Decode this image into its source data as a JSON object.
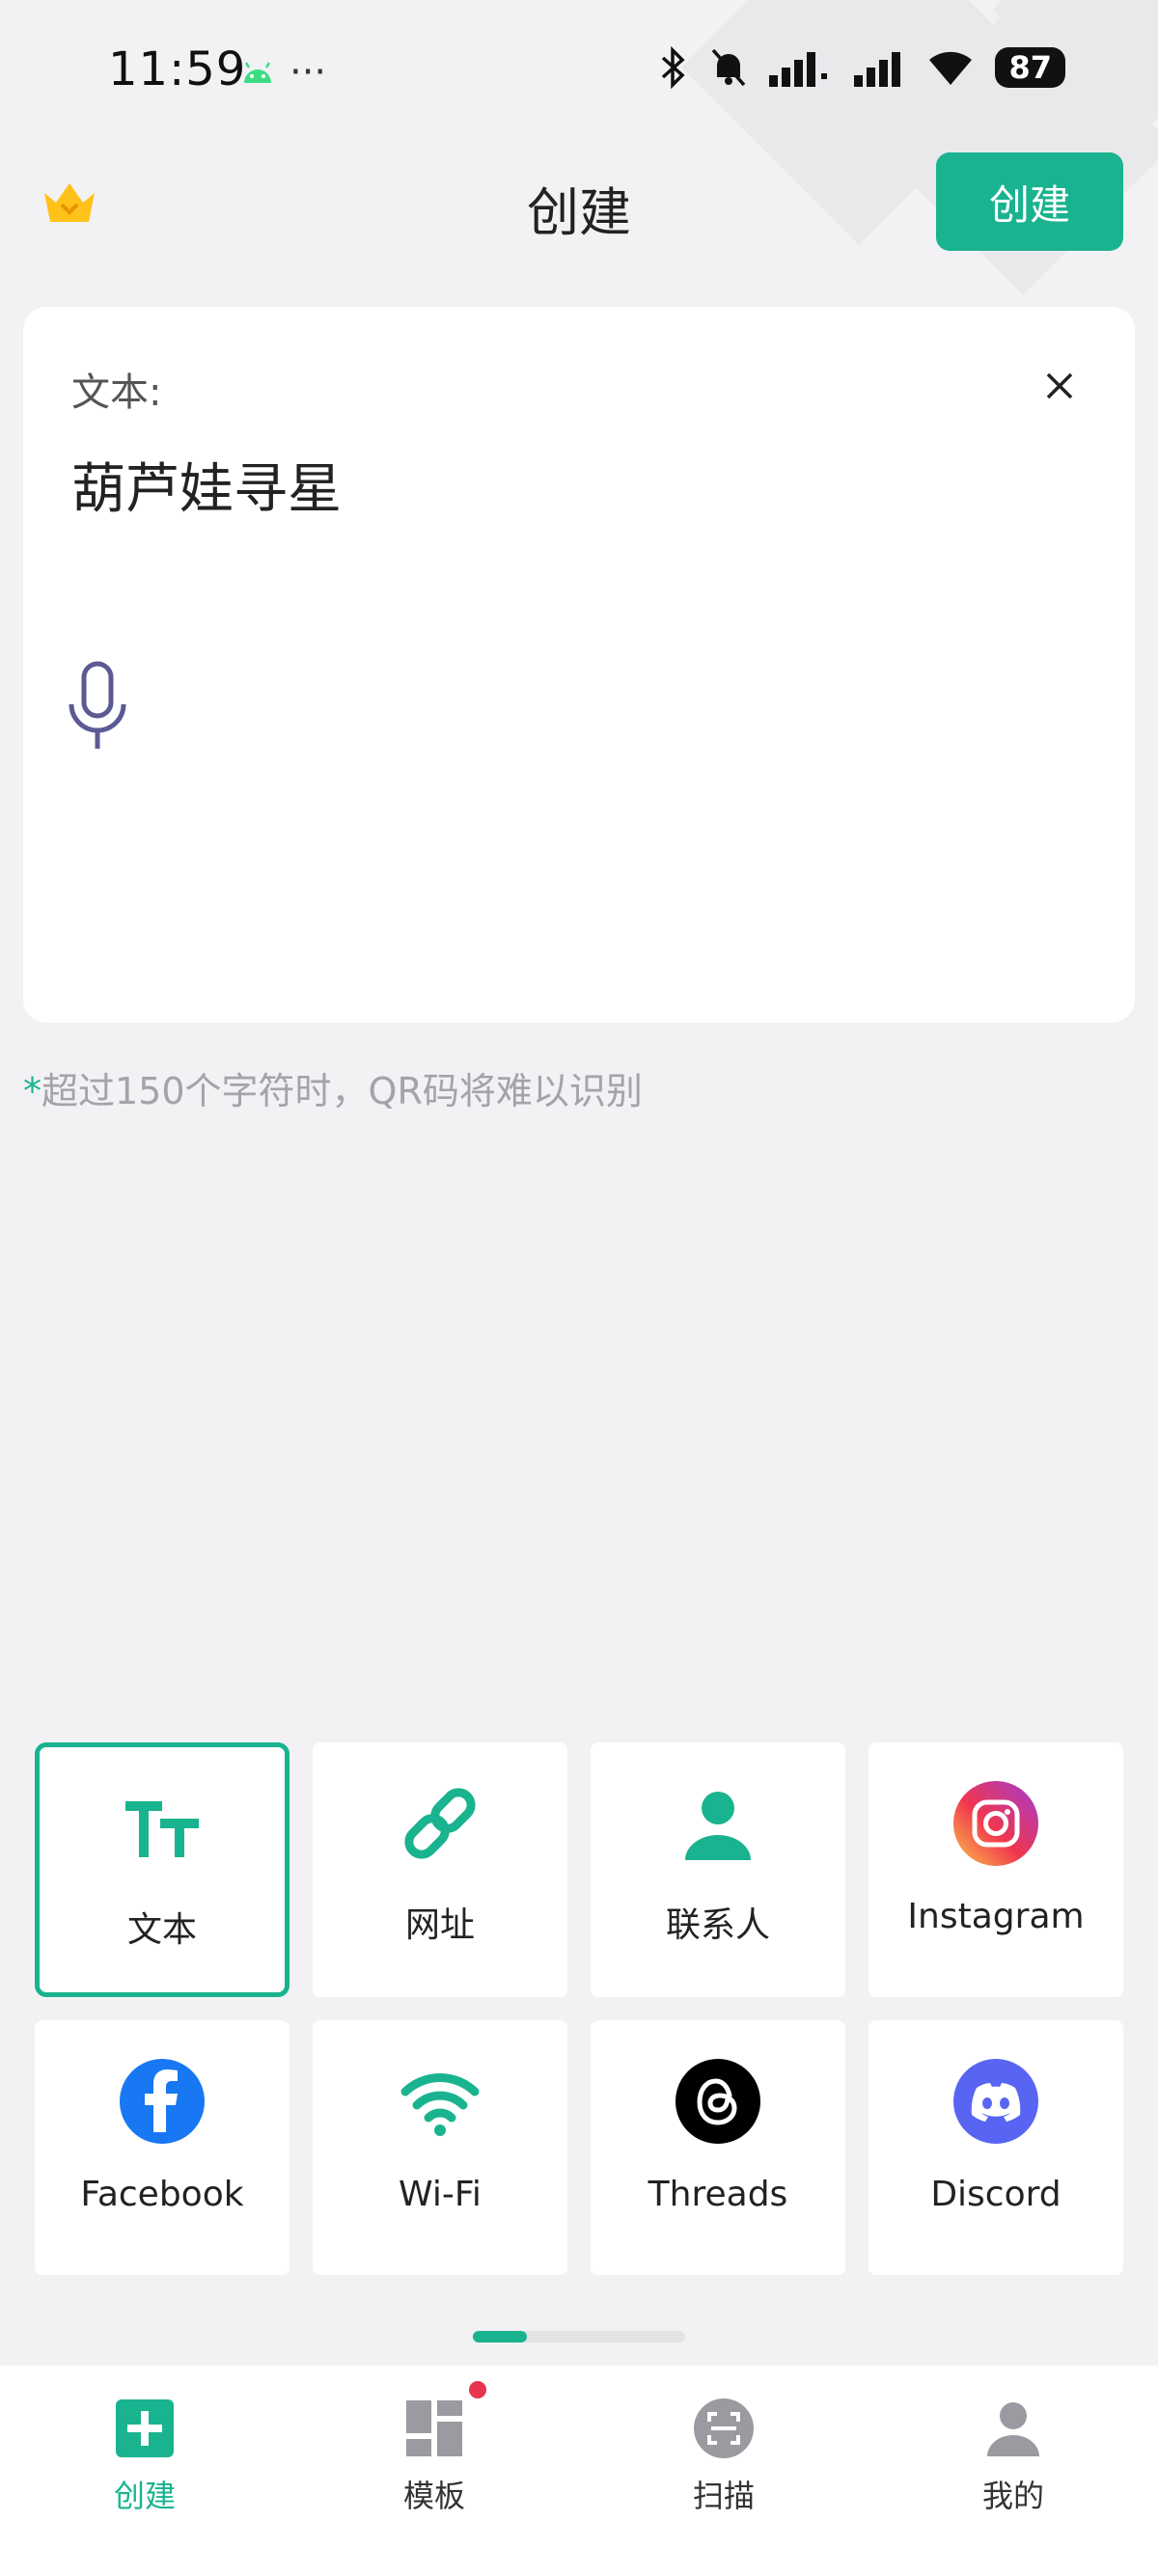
{
  "status_bar": {
    "time": "11:59",
    "more": "···",
    "battery": "87",
    "icons": [
      "android-icon",
      "bluetooth-icon",
      "bell-muted-icon",
      "signal-icon",
      "signal-icon",
      "wifi-icon",
      "battery-icon"
    ]
  },
  "header": {
    "title": "创建",
    "create_button": "创建",
    "crown_icon": "crown-icon"
  },
  "editor": {
    "label": "文本:",
    "value": "葫芦娃寻星",
    "close_icon": "close-icon",
    "mic_icon": "microphone-icon"
  },
  "hint": {
    "star": "*",
    "text": "超过150个字符时，QR码将难以识别"
  },
  "types": [
    {
      "label": "文本",
      "icon": "text-icon",
      "selected": true
    },
    {
      "label": "网址",
      "icon": "link-icon"
    },
    {
      "label": "联系人",
      "icon": "person-icon"
    },
    {
      "label": "Instagram",
      "icon": "instagram-icon"
    },
    {
      "label": "Facebook",
      "icon": "facebook-icon"
    },
    {
      "label": "Wi-Fi",
      "icon": "wifi-icon"
    },
    {
      "label": "Threads",
      "icon": "threads-icon"
    },
    {
      "label": "Discord",
      "icon": "discord-icon"
    }
  ],
  "pager": {
    "pages": 2,
    "current": 1
  },
  "bottom_nav": [
    {
      "label": "创建",
      "icon": "plus-icon",
      "active": true
    },
    {
      "label": "模板",
      "icon": "template-icon",
      "badge": true
    },
    {
      "label": "扫描",
      "icon": "scan-icon"
    },
    {
      "label": "我的",
      "icon": "profile-icon"
    }
  ],
  "colors": {
    "accent": "#1ab38f",
    "background": "#f2f2f4",
    "badge": "#e8344e",
    "facebook": "#1877f2",
    "discord": "#5865f2"
  }
}
